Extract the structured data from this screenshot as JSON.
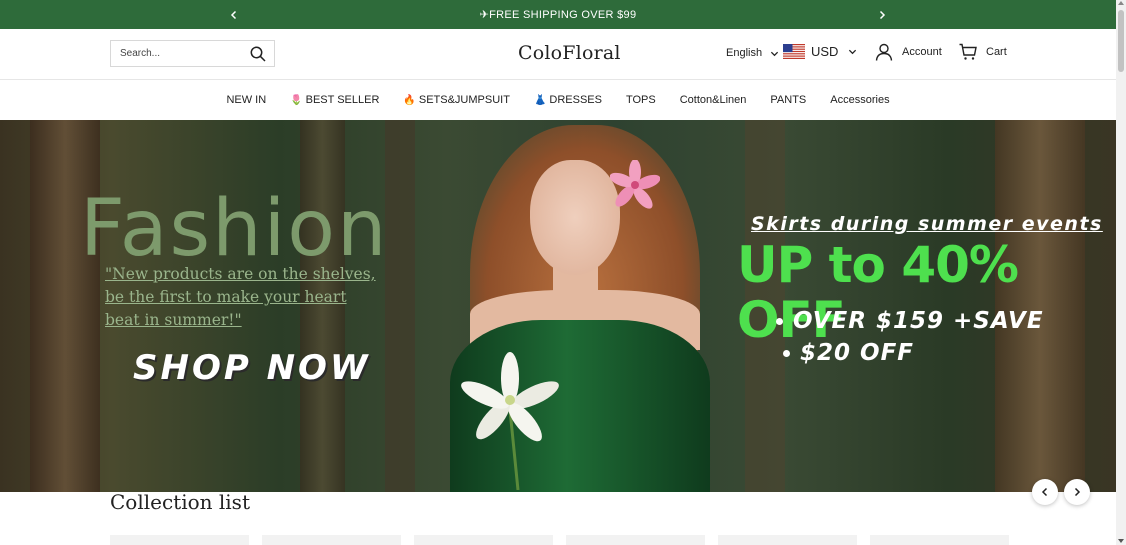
{
  "announcement": {
    "text": "✈FREE SHIPPING OVER $99",
    "background": "#2e6b3a"
  },
  "header": {
    "search_placeholder": "Search...",
    "logo": "ColoFloral",
    "language": "English",
    "currency": "USD",
    "account_label": "Account",
    "cart_label": "Cart"
  },
  "nav": {
    "items": [
      {
        "label": "NEW IN",
        "emoji": ""
      },
      {
        "label": "BEST SELLER",
        "emoji": "🌷"
      },
      {
        "label": "SETS&JUMPSUIT",
        "emoji": "🔥"
      },
      {
        "label": "DRESSES",
        "emoji": "👗"
      },
      {
        "label": "TOPS",
        "emoji": ""
      },
      {
        "label": "Cotton&Linen",
        "emoji": ""
      },
      {
        "label": "PANTS",
        "emoji": ""
      },
      {
        "label": "Accessories",
        "emoji": ""
      }
    ]
  },
  "hero": {
    "fashion": "Fashion",
    "tagline": "\"New products are on the shelves, be the first to make your heart beat in summer!\"",
    "cta": "SHOP NOW",
    "skirts": "Skirts during summer events",
    "promo": "UP to 40% OFF",
    "line1": "OVER $159 +SAVE",
    "line2": "$20 OFF",
    "promo_color": "#4ee04e"
  },
  "collection": {
    "title": "Collection list"
  }
}
